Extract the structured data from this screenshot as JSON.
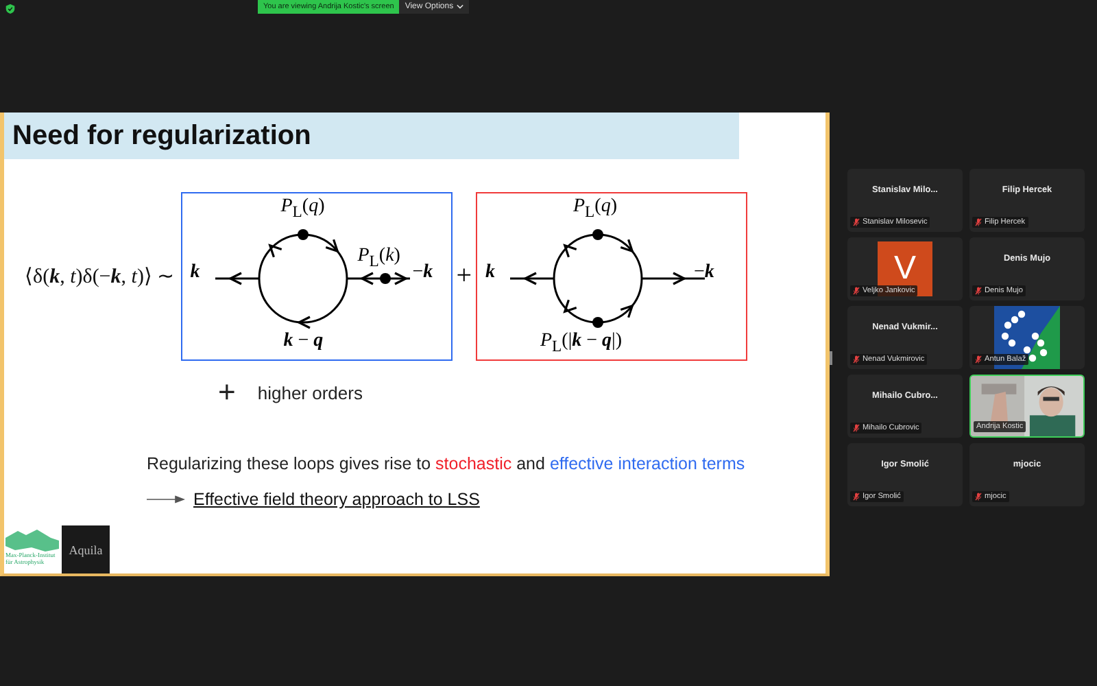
{
  "top_bar": {
    "banner": "You are viewing Andrija Kostic's screen",
    "view_options": "View Options"
  },
  "slide": {
    "title": "Need for regularization",
    "lhs": "⟨δ(**k**, *t*)δ(−**k**, *t*)⟩ ∼",
    "diagrams": [
      {
        "kind": "leg-propagator",
        "color": "#2f6bf0",
        "labels": {
          "top": "*P*$_{L}$(*q*)",
          "leg": "*P*$_{L}$(*k*)",
          "left": "**k**",
          "right": "−**k**",
          "bottom": "**k** − **q**"
        }
      },
      {
        "kind": "loop-propagators",
        "color": "#f03a3a",
        "labels": {
          "top": "*P*$_{L}$(*q*)",
          "left": "**k**",
          "right": "−**k**",
          "bottom": "*P*$_{L}$(|**k** − **q**|)"
        }
      }
    ],
    "between": "+",
    "higher_orders": {
      "plus": "+",
      "text": "higher orders"
    },
    "sentence": [
      {
        "text": "Regularizing these loops gives rise to ",
        "color": "#222222"
      },
      {
        "text": "stochastic",
        "color": "#f0202a"
      },
      {
        "text": " and ",
        "color": "#222222"
      },
      {
        "text": "effective interaction terms",
        "color": "#2f6bf0"
      }
    ],
    "bullet": "Effective field theory approach to LSS",
    "logos": {
      "institute": "Max-Planck-Institut für Astrophysik",
      "aquila": "Aquila"
    }
  },
  "participants": [
    {
      "kind": "name",
      "title": "Stanislav Milo...",
      "label": "Stanislav Milosevic",
      "muted": true,
      "speaking": false
    },
    {
      "kind": "name",
      "title": "Filip Hercek",
      "label": "Filip Hercek",
      "muted": true,
      "speaking": false
    },
    {
      "kind": "avatar",
      "letter": "V",
      "label": "Veljko Jankovic",
      "muted": true,
      "speaking": false
    },
    {
      "kind": "name",
      "title": "Denis Mujo",
      "label": "Denis Mujo",
      "muted": true,
      "speaking": false
    },
    {
      "kind": "name",
      "title": "Nenad Vukmir...",
      "label": "Nenad Vukmirovic",
      "muted": true,
      "speaking": false
    },
    {
      "kind": "logo",
      "label": "Antun Balaž",
      "muted": true,
      "speaking": false
    },
    {
      "kind": "name",
      "title": "Mihailo Cubro...",
      "label": "Mihailo Cubrovic",
      "muted": true,
      "speaking": false
    },
    {
      "kind": "video",
      "label": "Andrija Kostic",
      "muted": false,
      "speaking": true
    },
    {
      "kind": "name",
      "title": "Igor Smolić",
      "label": "Igor Smolić",
      "muted": true,
      "speaking": false
    },
    {
      "kind": "name",
      "title": "mjocic",
      "label": "mjocic",
      "muted": true,
      "speaking": false
    }
  ]
}
